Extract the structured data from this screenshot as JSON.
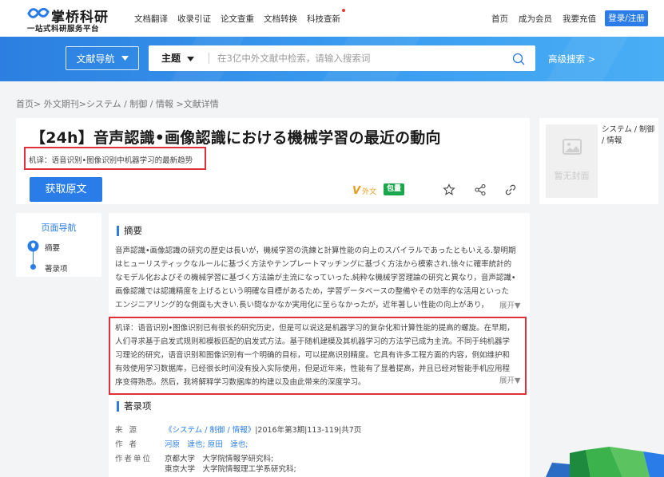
{
  "header": {
    "logo_name": "掌桥科研",
    "logo_sub": "一站式科研服务平台",
    "nav": [
      "文档翻译",
      "收录引证",
      "论文查重",
      "文档转换",
      "科技查新"
    ],
    "links": [
      "首页",
      "成为会员",
      "我要充值"
    ],
    "login_label": "登录/注册"
  },
  "search": {
    "nav_label": "文献导航",
    "theme_label": "主题",
    "placeholder": "在3亿中外文献中检索，请输入搜索词",
    "advanced_label": "高级搜索 >"
  },
  "breadcrumb": "首页> 外文期刊>システム / 制御 / 情報 >文献详情",
  "article": {
    "title": "【24h】音声認識•画像認識における機械学習の最近の動向",
    "machine_title": "机译：语音识别•图像识别中机器学习的最新趋势",
    "get_label": "获取原文",
    "wai_label": "外文",
    "bao_label": "包量"
  },
  "cover": {
    "no_cover": "暂无封面",
    "category": "システム / 制御 / 情報"
  },
  "sidenav": {
    "title": "页面导航",
    "items": [
      "摘要",
      "著录项"
    ]
  },
  "abstract": {
    "heading": "摘要",
    "lines": [
      "音声認識•画像認識の研究の歴史は長いが，機械学習の洗練と計算性能の向上のスパイラルであったともいえる.黎明期",
      "はヒューリスティックなルールに基づく方法やテンプレートマッチングに基づく方法から模索され.徐々に確率統計的",
      "なモデル化およびその機械学習に基づく方法論が主流になっていった.純粋な機械学習理論の研究と異なり，音声認識•",
      "画像認識では認識精度を上げるという明確な目標があるため，学習データベースの整備やその効率的な活用といった",
      "エンジニアリング的な側面も大きい.長い間なかなか実用化に至らなかったが，近年著しい性能の向上があり，"
    ],
    "expand": "展开▼",
    "mt_lines": [
      "机译：语音识别•图像识别已有很长的研究历史，但是可以说这是机器学习的复杂化和计算性能的提高的螺旋。在早期，",
      "人们寻求基于启发式规则和模板匹配的启发式方法。基于随机建模及其机器学习的方法学已成为主流。不同于纯机器学",
      "习理论的研究，语音识别和图像识别有一个明确的目标，可以提高识别精度。它具有许多工程方面的内容，例如维护和",
      "有效使用学习数据库，已经很长时间没有投入实际使用，但是近年来，性能有了显着提高，并且已经对智能手机应用程",
      "序变得熟悉。然后，我将解释学习数据库的构建以及由此带来的深度学习。"
    ],
    "mt_expand": "展开▼"
  },
  "record": {
    "heading": "著录项",
    "source_key": "来源",
    "source_link": "《システム / 制御 / 情報》",
    "source_rest": "|2016年第3期|113-119|共7页",
    "author_key": "作者",
    "authors": "河原　達也; 原田　達也;",
    "unit_key": "作者单位",
    "units": [
      "京都大学　大学院情報学研究科;",
      "東京大学　大学院情報理工学系研究科;"
    ]
  },
  "colors": {
    "primary": "#2a7de8",
    "highlight_border": "#e0313a",
    "badge_green": "#1aa64a"
  }
}
